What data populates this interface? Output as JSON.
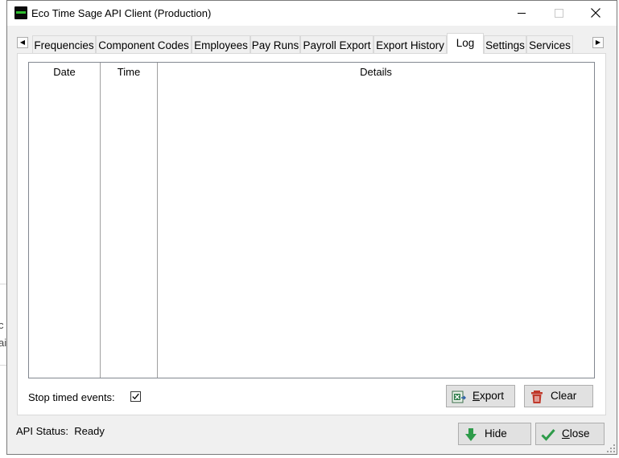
{
  "window": {
    "title": "Eco Time Sage API Client (Production)",
    "app_icon": "eco-time-logo-icon"
  },
  "tabs": [
    {
      "label": "Frequencies",
      "active": false
    },
    {
      "label": "Component Codes",
      "active": false
    },
    {
      "label": "Employees",
      "active": false
    },
    {
      "label": "Pay Runs",
      "active": false
    },
    {
      "label": "Payroll Export",
      "active": false
    },
    {
      "label": "Export History",
      "active": false
    },
    {
      "label": "Log",
      "active": true
    },
    {
      "label": "Settings",
      "active": false
    },
    {
      "label": "Services",
      "active": false
    }
  ],
  "log": {
    "columns": [
      "Date",
      "Time",
      "Details"
    ],
    "rows": []
  },
  "options": {
    "stop_timed_events_label": "Stop timed events:",
    "stop_timed_events_checked": true
  },
  "buttons": {
    "export": {
      "first": "E",
      "rest": "xport",
      "icon": "excel-icon"
    },
    "clear": {
      "first": "",
      "rest": "Clear",
      "icon": "trash-icon"
    },
    "hide": {
      "first": "",
      "rest": "Hide",
      "icon": "arrow-down-icon"
    },
    "close": {
      "first": "C",
      "rest": "lose",
      "icon": "checkmark-icon"
    }
  },
  "status": {
    "label": "API Status:",
    "value": "Ready"
  },
  "background": {
    "fragment_1": "c",
    "fragment_2": "ai"
  },
  "colors": {
    "accent_green": "#2e9b4a",
    "clear_red": "#c0392b"
  }
}
